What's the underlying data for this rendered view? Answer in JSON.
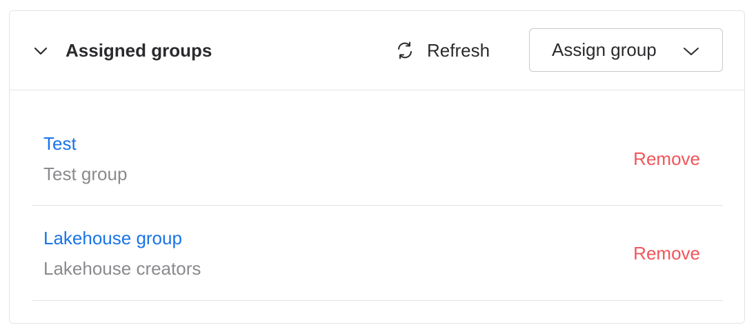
{
  "panel": {
    "title": "Assigned groups",
    "collapse_icon": "chevron-down-icon"
  },
  "toolbar": {
    "refresh_label": "Refresh",
    "refresh_icon": "refresh-icon",
    "assign_label": "Assign group",
    "assign_icon": "chevron-down-icon"
  },
  "groups": [
    {
      "name": "Test",
      "description": "Test group",
      "action": "Remove"
    },
    {
      "name": "Lakehouse group",
      "description": "Lakehouse creators",
      "action": "Remove"
    }
  ],
  "colors": {
    "link": "#1a73e8",
    "danger": "#f0555a",
    "muted": "#8a8a8e",
    "text": "#2b2b2e"
  }
}
